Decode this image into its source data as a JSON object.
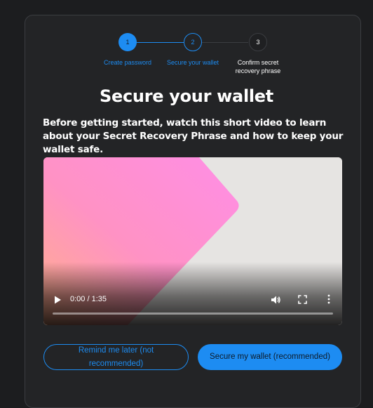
{
  "stepper": {
    "steps": [
      {
        "number": "1",
        "label": "Create password",
        "state": "complete"
      },
      {
        "number": "2",
        "label": "Secure your wallet",
        "state": "active"
      },
      {
        "number": "3",
        "label": "Confirm secret recovery phrase",
        "state": "upcoming"
      }
    ]
  },
  "page": {
    "title": "Secure your wallet",
    "intro": "Before getting started, watch this short video to learn about your Secret Recovery Phrase and how to keep your wallet safe."
  },
  "video": {
    "current_time": "0:00",
    "duration": "1:35",
    "time_display": "0:00 / 1:35",
    "progress": 0,
    "controls": [
      "play-icon",
      "volume-icon",
      "fullscreen-icon",
      "more-options-icon"
    ]
  },
  "buttons": {
    "remind_later": "Remind me later (not recommended)",
    "secure_wallet": "Secure my wallet (recommended)"
  },
  "colors": {
    "accent": "#1d8cf2",
    "background": "#1c1d1f",
    "card": "#232426",
    "text": "#ffffff",
    "muted_line": "#3b3d41"
  }
}
